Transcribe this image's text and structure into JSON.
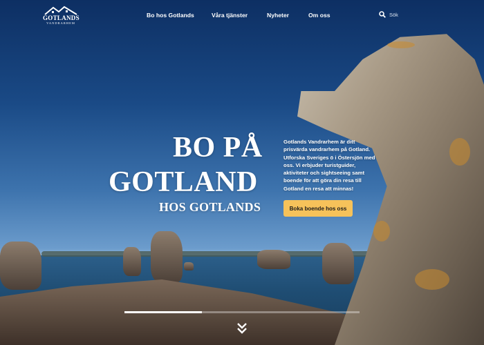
{
  "logo": {
    "title": "GOTLANDS",
    "subtitle": "VANDRARHEM"
  },
  "nav": {
    "items": [
      "Bo hos Gotlands",
      "Våra tjänster",
      "Nyheter",
      "Om oss"
    ]
  },
  "search": {
    "placeholder": "Sök",
    "icon": "search-icon"
  },
  "hero": {
    "title_line1": "BO PÅ",
    "title_line2": "GOTLAND",
    "title_line3": "HOS GOTLANDS",
    "description": "Gotlands Vandrarhem är ditt prisvärda vandrarhem på Gotland. Utforska Sveriges ö i Östersjön med oss. Vi erbjuder turistguider, aktiviteter och sightseeing samt boende för att göra din resa till Gotland en resa att minnas!",
    "cta_label": "Boka boende hos oss",
    "cta_color": "#f6c25a"
  },
  "slider": {
    "progress": 0.33
  },
  "scroll_icon": "double-chevron-down-icon"
}
